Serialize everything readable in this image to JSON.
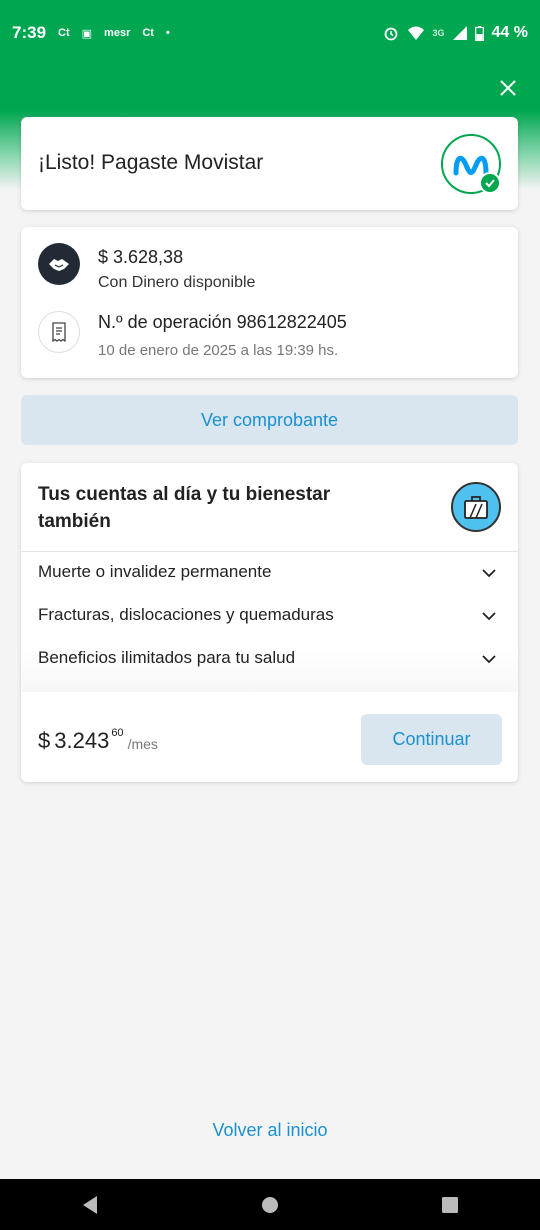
{
  "status_bar": {
    "time": "7:39",
    "notif_icons": [
      "Ct",
      "▣",
      "mesr",
      "Ct",
      "•"
    ],
    "network": "3G",
    "battery": "44 %"
  },
  "header": {
    "title": "¡Listo! Pagaste Movistar",
    "close_icon": "close-icon"
  },
  "payment": {
    "amount": "$ 3.628,38",
    "method": "Con Dinero disponible",
    "operation": "N.º de operación 98612822405",
    "date": "10 de enero de 2025 a las 19:39 hs."
  },
  "actions": {
    "ver_comprobante": "Ver comprobante",
    "volver": "Volver al inicio"
  },
  "insurance": {
    "title": "Tus cuentas al día y tu bienestar también",
    "items": [
      {
        "label": "Muerte o invalidez permanente"
      },
      {
        "label": "Fracturas, dislocaciones y quemaduras"
      },
      {
        "label": "Beneficios ilimitados para tu salud"
      }
    ],
    "price": {
      "currency": "$",
      "integer": "3.243",
      "cents": "60",
      "period": "/mes"
    },
    "continue_label": "Continuar"
  },
  "colors": {
    "brand_green": "#00a650",
    "link_blue": "#1a91d0",
    "button_bg": "#d9e5ef",
    "movistar_blue": "#019df4"
  }
}
